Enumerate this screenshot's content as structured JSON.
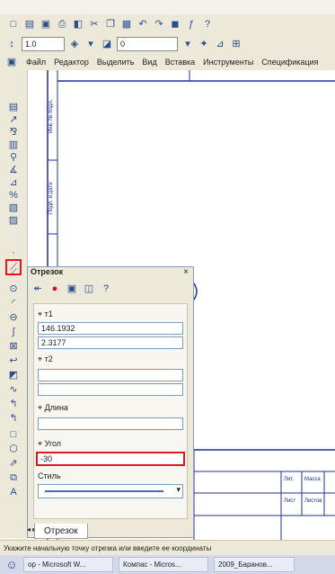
{
  "toolbar_top": {
    "zoom_value": "1.0",
    "layer_value": "0"
  },
  "menubar": {
    "items": [
      "Файл",
      "Редактор",
      "Выделить",
      "Вид",
      "Вставка",
      "Инструменты",
      "Спецификация"
    ]
  },
  "panel": {
    "title": "Отрезок",
    "close_label": "×",
    "fields": {
      "t1_label": "т1",
      "t1_x": "146.1932",
      "t1_y": "2.3177",
      "t2_label": "т2",
      "length_label": "Длина",
      "angle_label": "Угол",
      "angle_value": "-30",
      "style_label": "Стиль"
    },
    "tab_label": "Отрезок"
  },
  "drawing": {
    "title_block_labels": [
      "Лит.",
      "Масса",
      "Лист",
      "Листов"
    ]
  },
  "status": {
    "text": "Укажите начальную точку отрезка или введите ее координаты"
  },
  "taskbar": {
    "items": [
      "op - Microsoft W...",
      "Компас - Micros...",
      "2009_Баранов..."
    ]
  },
  "colors": {
    "drawing_blue": "#1f2f9a",
    "highlight_red": "#e0191f",
    "panel_bg": "#ece9d8"
  }
}
